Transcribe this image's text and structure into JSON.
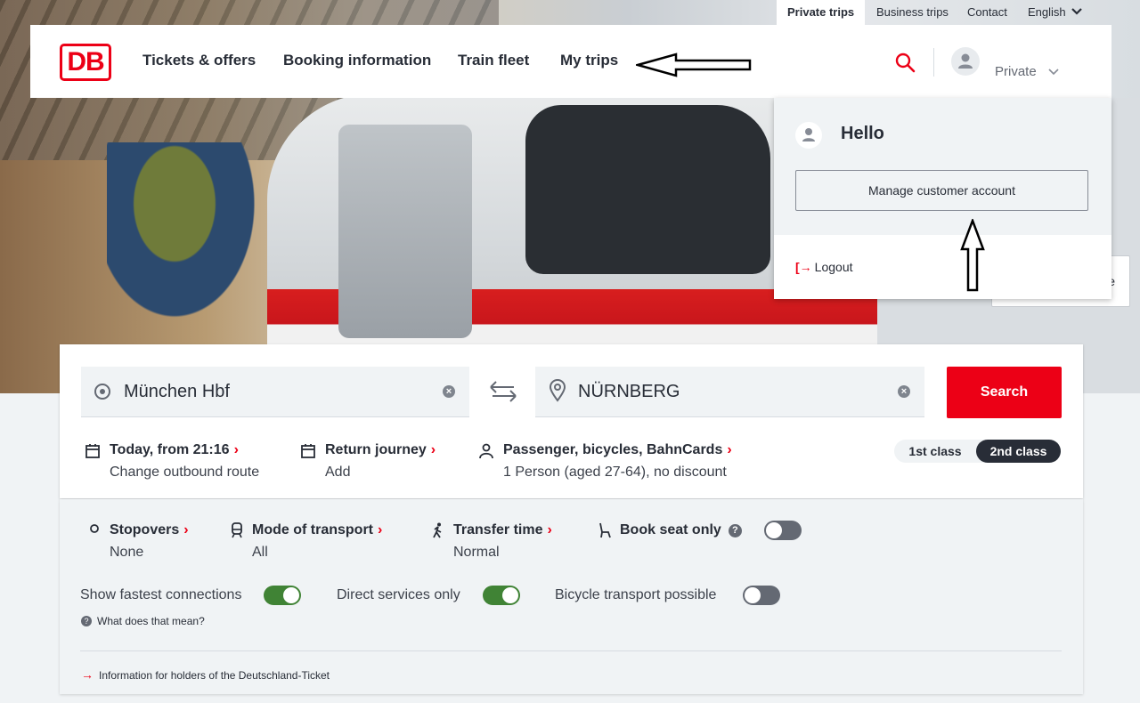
{
  "meta_nav": {
    "private_trips": "Private trips",
    "business_trips": "Business trips",
    "contact": "Contact",
    "language": "English"
  },
  "header": {
    "logo": "DB",
    "nav": [
      "Tickets & offers",
      "Booking information",
      "Train fleet",
      "My trips"
    ],
    "account_label": "Private"
  },
  "account_menu": {
    "greeting": "Hello",
    "manage_button": "Manage customer account",
    "logout": "Logout"
  },
  "search": {
    "from": "München Hbf",
    "to": "NÜRNBERG",
    "search_button": "Search",
    "outbound": {
      "title": "Today, from 21:16",
      "subtitle": "Change outbound route"
    },
    "return": {
      "title": "Return journey",
      "subtitle": "Add"
    },
    "passengers": {
      "title": "Passenger, bicycles, BahnCards",
      "subtitle": "1 Person (aged 27-64), no discount"
    },
    "class_first": "1st class",
    "class_second": "2nd class",
    "selected_class": "2nd class"
  },
  "advanced": {
    "stopovers": {
      "title": "Stopovers",
      "value": "None"
    },
    "mode": {
      "title": "Mode of transport",
      "value": "All"
    },
    "transfer": {
      "title": "Transfer time",
      "value": "Normal"
    },
    "seat_only": {
      "title": "Book seat only",
      "enabled": false
    },
    "fastest": {
      "label": "Show fastest connections",
      "enabled": true
    },
    "direct": {
      "label": "Direct services only",
      "enabled": true
    },
    "bicycle": {
      "label": "Bicycle transport possible",
      "enabled": false
    },
    "help": "What does that mean?",
    "info": "Information for holders of the Deutschland-Ticket"
  },
  "colors": {
    "brand_red": "#ec0016",
    "toggle_on": "#408335",
    "dark": "#282d37"
  }
}
